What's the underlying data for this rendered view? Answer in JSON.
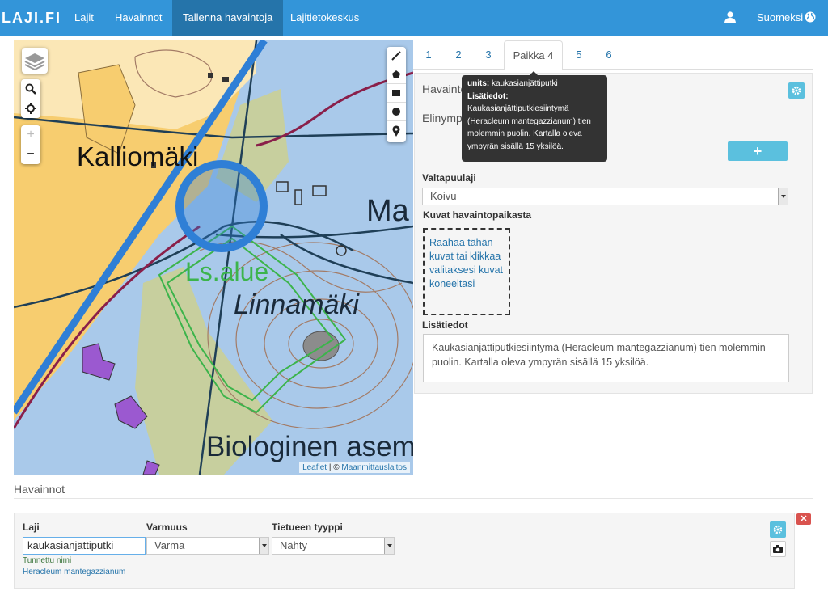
{
  "navbar": {
    "brand": "LAJI.FI",
    "items": [
      {
        "label": "Lajit"
      },
      {
        "label": "Havainnot"
      },
      {
        "label": "Tallenna havaintoja"
      },
      {
        "label": "Lajitietokeskus"
      }
    ],
    "language": "Suomeksi",
    "user_icon": "user-icon",
    "globe_icon": "globe-icon"
  },
  "map": {
    "labels": {
      "kalliomaki": "Kalliomäki",
      "ma": "Ma",
      "lsalue": "Ls.alue",
      "linnamaki": "Linnamäki",
      "biologinen": "Biologinen asem"
    },
    "zoom_in": "+",
    "zoom_out": "−",
    "attribution": {
      "leaflet": "Leaflet",
      "sep": " | © ",
      "source": "Maanmittauslaitos"
    }
  },
  "tabs": [
    {
      "label": "1"
    },
    {
      "label": "2"
    },
    {
      "label": "3"
    },
    {
      "label": "Paikka 4"
    },
    {
      "label": "5"
    },
    {
      "label": "6"
    }
  ],
  "place_panel": {
    "heading1": "Havaintopaikan tiedot",
    "heading2": "Elinympäristö",
    "valtapuulaji_label": "Valtapuulaji",
    "valtapuulaji_value": "Koivu",
    "images_label": "Kuvat havaintopaikasta",
    "dropzone_text": "Raahaa tähän kuvat tai klikkaa valitaksesi kuvat koneeltasi",
    "lisatiedot_label": "Lisätiedot",
    "lisatiedot_value": "Kaukasianjättiputkiesiintymä (Heracleum mantegazzianum) tien molemmin puolin. Kartalla oleva ympyrän sisällä 15 yksilöä."
  },
  "tooltip": {
    "units_label": "units:",
    "units_value": "kaukasianjättiputki",
    "lisatiedot_label": "Lisätiedot:",
    "text": "Kaukasianjättiputkiesiintymä (Heracleum mantegazzianum) tien molemmin puolin. Kartalla oleva ympyrän sisällä 15 yksilöä."
  },
  "observations": {
    "title": "Havainnot",
    "laji_label": "Laji",
    "laji_value": "kaukasianjättiputki",
    "varmuus_label": "Varmuus",
    "varmuus_value": "Varma",
    "tyyppi_label": "Tietueen tyyppi",
    "tyyppi_value": "Nähty",
    "recognized": "Tunnettu nimi",
    "scientific": "Heracleum mantegazzianum"
  },
  "colors": {
    "navbar": "#3395d9",
    "navbar_active": "#2574aa",
    "info_button": "#5bc0de",
    "danger": "#d9534f",
    "map_water": "#a9c9ea",
    "map_field": "#f7cd6f"
  }
}
